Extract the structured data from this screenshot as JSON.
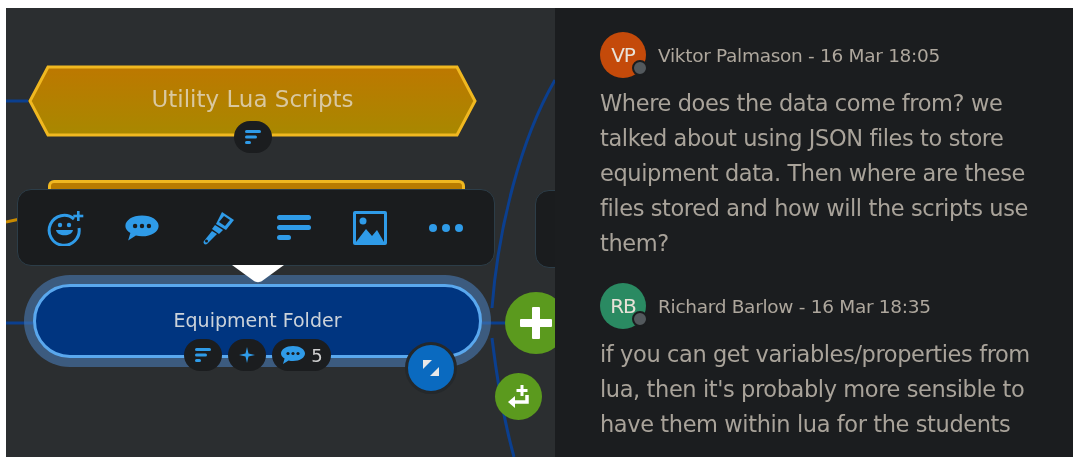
{
  "mind_map": {
    "topics": [
      {
        "kind": "hexagon",
        "label": "Utility Lua Scripts",
        "selected": false,
        "badges": [
          {
            "kind": "notes"
          }
        ]
      },
      {
        "kind": "pill",
        "label": "Equipment Folder",
        "selected": true,
        "badges": [
          {
            "kind": "notes"
          },
          {
            "kind": "sparkle"
          },
          {
            "kind": "comments",
            "count": "5"
          }
        ]
      }
    ],
    "toolbar": {
      "buttons": [
        {
          "kind": "emoji"
        },
        {
          "kind": "comment"
        },
        {
          "kind": "style"
        },
        {
          "kind": "notes"
        },
        {
          "kind": "image"
        },
        {
          "kind": "more"
        }
      ]
    }
  },
  "comments": [
    {
      "initials": "VP",
      "color": "#c44a0a",
      "byline": "Viktor Palmason - 16 Mar 18:05",
      "text": "Where does the data come from? we talked about using JSON files to store equipment data. Then where are these files stored and how will the scripts use them?"
    },
    {
      "initials": "RB",
      "color": "#2a8a62",
      "byline": "Richard Barlow - 16 Mar 18:35",
      "text": "if you can get variables/properties from lua, then it's probably more sensible to have them within lua for the students"
    }
  ]
}
